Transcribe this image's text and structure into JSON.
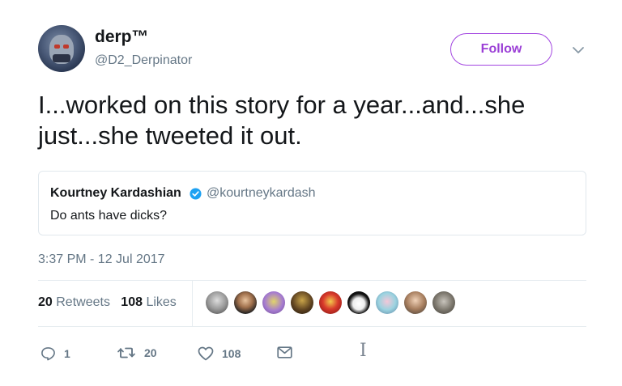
{
  "author": {
    "name": "derp™",
    "handle": "@D2_Derpinator",
    "avatar_icon": "robot-avatar"
  },
  "follow_label": "Follow",
  "tweet": {
    "text": "I...worked on this story for a year...and...she just...she tweeted it out.",
    "timestamp": "3:37 PM - 12 Jul 2017"
  },
  "quoted": {
    "name": "Kourtney Kardashian",
    "handle": "@kourtneykardash",
    "text": "Do ants have dicks?",
    "verified_color": "#1da1f2"
  },
  "stats": {
    "retweets_count": "20",
    "retweets_label": "Retweets",
    "likes_count": "108",
    "likes_label": "Likes"
  },
  "liker_avatars": [
    "liker-avatar-1",
    "liker-avatar-2",
    "liker-avatar-3",
    "liker-avatar-4",
    "liker-avatar-5",
    "liker-avatar-6",
    "liker-avatar-7",
    "liker-avatar-8",
    "liker-avatar-9"
  ],
  "actions": {
    "reply_count": "1",
    "retweet_count": "20",
    "like_count": "108"
  },
  "colors": {
    "follow": "#9b3fd6",
    "muted": "#657786",
    "text": "#14171a"
  }
}
